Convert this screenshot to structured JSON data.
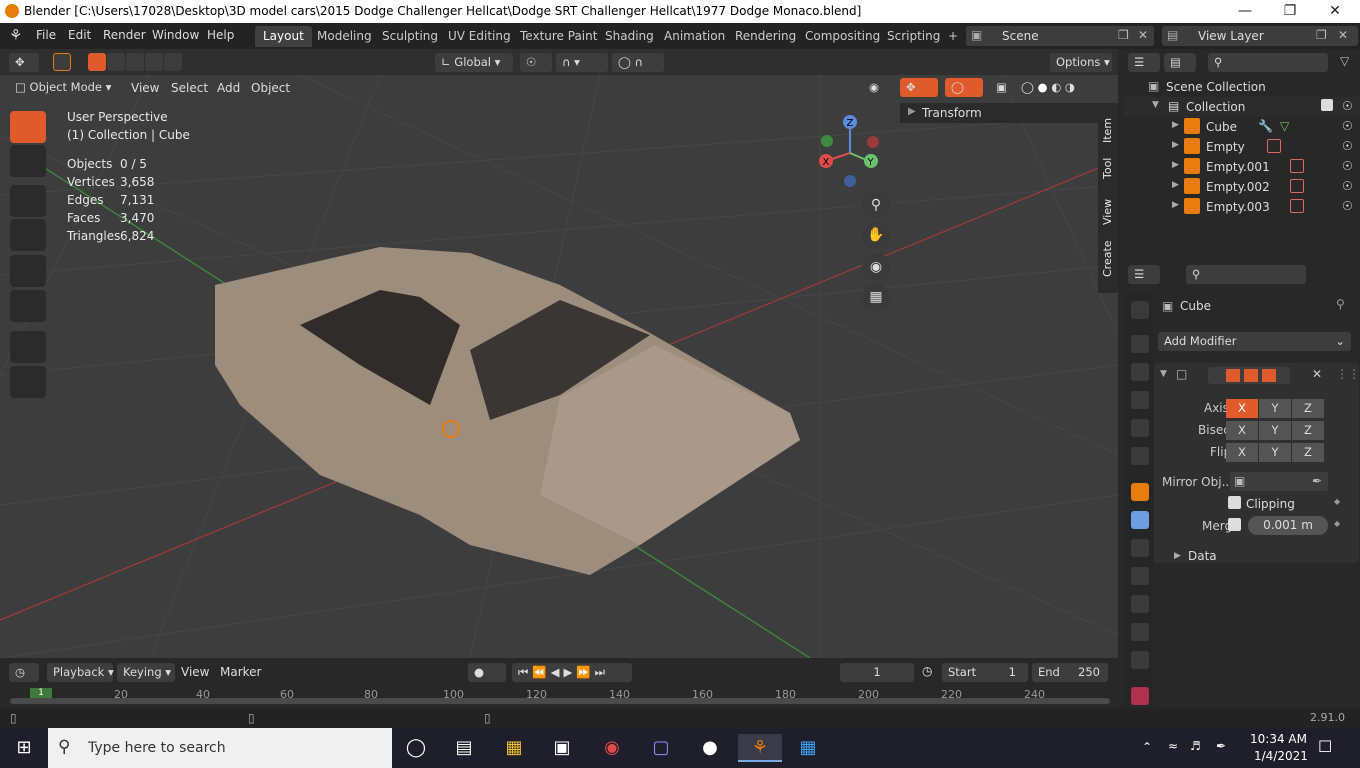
{
  "window": {
    "title": "Blender [C:\\Users\\17028\\Desktop\\3D model cars\\2015 Dodge Challenger Hellcat\\Dodge SRT Challenger Hellcat\\1977 Dodge Monaco.blend]"
  },
  "menubar": {
    "items": [
      "File",
      "Edit",
      "Render",
      "Window",
      "Help"
    ]
  },
  "workspaces": [
    "Layout",
    "Modeling",
    "Sculpting",
    "UV Editing",
    "Texture Paint",
    "Shading",
    "Animation",
    "Rendering",
    "Compositing",
    "Scripting"
  ],
  "scene": {
    "label": "Scene"
  },
  "view_layer": {
    "label": "View Layer"
  },
  "toolbar": {
    "orientation": "Global",
    "options": "Options"
  },
  "viewport_header": {
    "mode": "Object Mode",
    "menus": [
      "View",
      "Select",
      "Add",
      "Object"
    ]
  },
  "viewport": {
    "perspective": "User Perspective",
    "collection": "(1) Collection | Cube",
    "stats": [
      {
        "label": "Objects",
        "value": "0 / 5"
      },
      {
        "label": "Vertices",
        "value": "3,658"
      },
      {
        "label": "Edges",
        "value": "7,131"
      },
      {
        "label": "Faces",
        "value": "3,470"
      },
      {
        "label": "Triangles",
        "value": "6,824"
      }
    ],
    "gizmo": {
      "x": "X",
      "y": "Y",
      "z": "Z"
    },
    "transform_panel": "Transform",
    "side_tabs": [
      "Item",
      "Tool",
      "View",
      "Create"
    ]
  },
  "outliner": {
    "root": "Scene Collection",
    "collection": "Collection",
    "items": [
      "Cube",
      "Empty",
      "Empty.001",
      "Empty.002",
      "Empty.003"
    ]
  },
  "properties": {
    "object_name": "Cube",
    "add_modifier": "Add Modifier",
    "axis_label": "Axis",
    "bisect_label": "Bisect",
    "flip_label": "Flip",
    "axes": [
      "X",
      "Y",
      "Z"
    ],
    "mirror_object_label": "Mirror Obj...",
    "clipping_label": "Clipping",
    "merge_label": "Merge",
    "merge_value": "0.001 m",
    "data_label": "Data"
  },
  "timeline": {
    "menus": [
      "Playback",
      "Keying",
      "View",
      "Marker"
    ],
    "current_frame": "1",
    "start_label": "Start",
    "start_value": "1",
    "end_label": "End",
    "end_value": "250",
    "ticks": [
      "20",
      "40",
      "60",
      "80",
      "100",
      "120",
      "140",
      "160",
      "180",
      "200",
      "220",
      "240"
    ],
    "current_marker": "1"
  },
  "status": {
    "version": "2.91.0"
  },
  "taskbar": {
    "search_placeholder": "Type here to search",
    "time": "10:34 AM",
    "date": "1/4/2021"
  }
}
